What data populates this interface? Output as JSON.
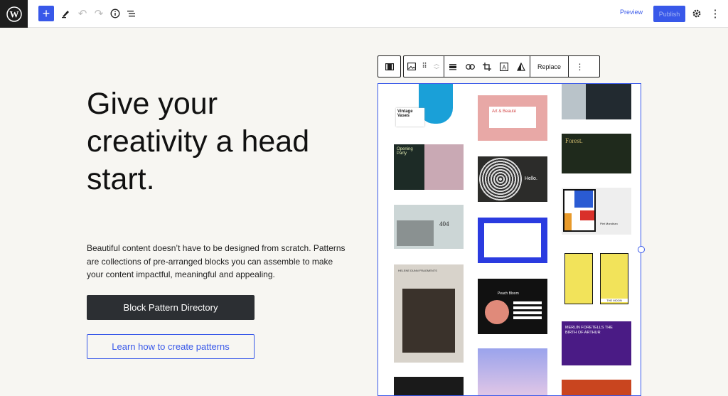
{
  "topbar": {
    "logo_icon": "wordpress-logo-icon",
    "add_icon": "plus-icon",
    "tools_icon": "pen-icon",
    "undo_icon": "undo-icon",
    "redo_icon": "redo-icon",
    "details_icon": "info-icon",
    "list_view_icon": "list-view-icon",
    "preview_label": "Preview",
    "publish_label": "Publish",
    "settings_icon": "gear-icon",
    "options_icon": "more-vertical-icon"
  },
  "hero": {
    "headline": "Give your creativity a head start.",
    "description": "Beautiful content doesn’t have to be designed from scratch. Patterns are collections of pre-arranged blocks you can assemble to make your content impactful, meaningful and appealing.",
    "primary_button": "Block Pattern Directory",
    "secondary_button": "Learn how to create patterns"
  },
  "block_toolbar": {
    "replace_label": "Replace"
  },
  "thumbnails": {
    "t1": "Vintage Vases",
    "t2": "Art & Beauté",
    "t3": "Opening Party",
    "t4": "Forest.",
    "t5": "Hello.",
    "t6": "404",
    "t7": "Piet Mondrian",
    "t8": "HELENE DUNN FRAGMENTS",
    "t9": "Peach Bloom",
    "t10": "MERLIN FORETELLS THE BIRTH OF ARTHUR",
    "t11": "THE MOON"
  },
  "colors": {
    "accent": "#3858e9",
    "dark_button": "#2c2f33",
    "background": "#f7f6f2"
  }
}
